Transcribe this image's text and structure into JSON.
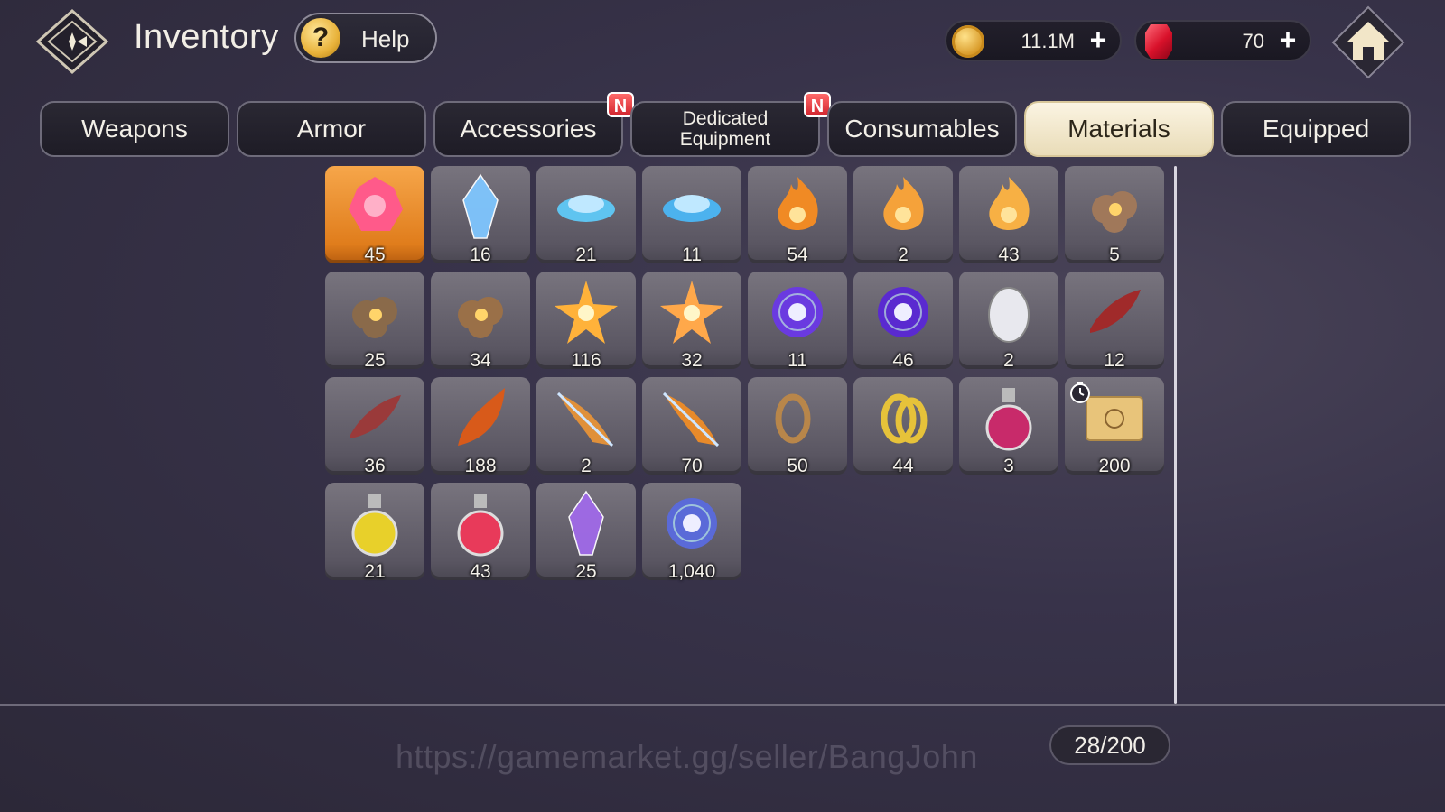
{
  "header": {
    "title": "Inventory",
    "help_label": "Help",
    "gold_value": "11.1M",
    "gem_value": "70"
  },
  "tabs": [
    {
      "label": "Weapons",
      "active": false,
      "badge": ""
    },
    {
      "label": "Armor",
      "active": false,
      "badge": ""
    },
    {
      "label": "Accessories",
      "active": false,
      "badge": "N"
    },
    {
      "label": "Dedicated\nEquipment",
      "active": false,
      "badge": "N"
    },
    {
      "label": "Consumables",
      "active": false,
      "badge": ""
    },
    {
      "label": "Materials",
      "active": true,
      "badge": ""
    },
    {
      "label": "Equipped",
      "active": false,
      "badge": ""
    }
  ],
  "items": [
    {
      "icon": "pink-rose-gem-icon",
      "count": "45",
      "color": "#ff5a8a"
    },
    {
      "icon": "blue-crystal-cluster-icon",
      "count": "16",
      "color": "#7fc6ff"
    },
    {
      "icon": "blue-ore-icon",
      "count": "21",
      "color": "#5fc4f0"
    },
    {
      "icon": "blue-ore-large-icon",
      "count": "11",
      "color": "#4cb2ee"
    },
    {
      "icon": "fire-essence-small-icon",
      "count": "54",
      "color": "#f08a24"
    },
    {
      "icon": "fire-essence-medium-icon",
      "count": "2",
      "color": "#f5a23a"
    },
    {
      "icon": "fire-essence-large-icon",
      "count": "43",
      "color": "#f7b044"
    },
    {
      "icon": "rock-core-icon",
      "count": "5",
      "color": "#a0785a"
    },
    {
      "icon": "rock-cluster-icon",
      "count": "25",
      "color": "#8a6a4a"
    },
    {
      "icon": "rock-burst-icon",
      "count": "34",
      "color": "#9a7048"
    },
    {
      "icon": "star-shard-icon",
      "count": "116",
      "color": "#ffb23a"
    },
    {
      "icon": "star-burst-icon",
      "count": "32",
      "color": "#ffa84a"
    },
    {
      "icon": "void-orb-small-icon",
      "count": "11",
      "color": "#6a3ae0"
    },
    {
      "icon": "void-orb-large-icon",
      "count": "46",
      "color": "#5a2ad0"
    },
    {
      "icon": "white-egg-icon",
      "count": "2",
      "color": "#e8e8ee"
    },
    {
      "icon": "red-leaf-icon",
      "count": "12",
      "color": "#a02a2a"
    },
    {
      "icon": "leather-strip-icon",
      "count": "36",
      "color": "#9a3a3a"
    },
    {
      "icon": "orange-horn-icon",
      "count": "188",
      "color": "#d85a1a"
    },
    {
      "icon": "feather-blade-icon",
      "count": "2",
      "color": "#e0903a"
    },
    {
      "icon": "feather-wing-icon",
      "count": "70",
      "color": "#e88a2a"
    },
    {
      "icon": "bronze-ring-icon",
      "count": "50",
      "color": "#b8864a"
    },
    {
      "icon": "gold-rings-icon",
      "count": "44",
      "color": "#e6c23a"
    },
    {
      "icon": "potion-vial-icon",
      "count": "3",
      "color": "#c82a6a"
    },
    {
      "icon": "treasure-map-icon",
      "count": "200",
      "color": "#e8c47a",
      "timed": true
    },
    {
      "icon": "yellow-flask-icon",
      "count": "21",
      "color": "#e8d02a"
    },
    {
      "icon": "red-flask-icon",
      "count": "43",
      "color": "#e83a5a"
    },
    {
      "icon": "purple-crystal-icon",
      "count": "25",
      "color": "#a06ae8"
    },
    {
      "icon": "star-orb-icon",
      "count": "1,040",
      "color": "#5a6ad8"
    }
  ],
  "watermark": "https://gamemarket.gg/seller/BangJohn",
  "capacity": "28/200",
  "colors": {
    "highlight_slot": "#e98a24",
    "active_tab": "#f5ecd4",
    "badge": "#e0343a"
  }
}
